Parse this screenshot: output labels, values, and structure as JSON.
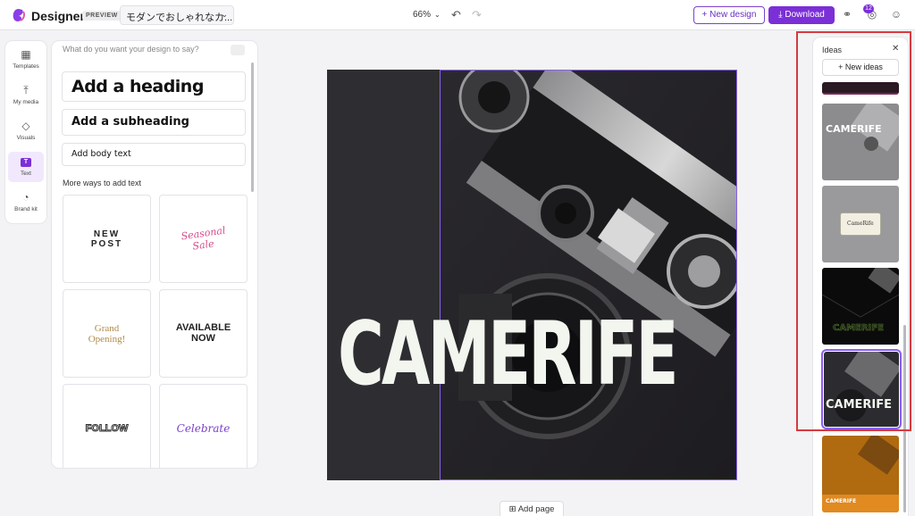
{
  "app": {
    "name": "Designer",
    "badge": "PREVIEW",
    "doc_title": "モダンでおしゃれなカ...",
    "zoom": "66%",
    "new_design": "New design",
    "download": "Download",
    "notifications": "12"
  },
  "rail": {
    "items": [
      {
        "label": "Templates",
        "icon": "templates-icon"
      },
      {
        "label": "My media",
        "icon": "upload-icon"
      },
      {
        "label": "Visuals",
        "icon": "shapes-icon"
      },
      {
        "label": "Text",
        "icon": "text-icon"
      },
      {
        "label": "Brand kit",
        "icon": "palette-icon"
      }
    ]
  },
  "text_panel": {
    "search_placeholder": "What do you want your design to say?",
    "add_heading": "Add a heading",
    "add_subheading": "Add a subheading",
    "add_body": "Add body text",
    "more_ways": "More ways to add text",
    "cards": [
      {
        "line1": "NEW",
        "line2": "POST"
      },
      {
        "line1": "Seasonal",
        "line2": "Sale"
      },
      {
        "line1": "Grand",
        "line2": "Opening!"
      },
      {
        "line1": "AVAILABLE",
        "line2": "NOW"
      },
      {
        "line1": "FOLLOW",
        "line2": ""
      },
      {
        "line1": "Celebrate",
        "line2": ""
      }
    ]
  },
  "canvas": {
    "headline": "CAMERIFE",
    "add_page": "Add page"
  },
  "ideas": {
    "title": "Ideas",
    "new_ideas": "New ideas",
    "thumbs": [
      {
        "caption": "CAMERIFE"
      },
      {
        "caption": "CameRife"
      },
      {
        "caption": "CAMERIFE"
      },
      {
        "caption": "CAMERIFE"
      },
      {
        "caption": "CAMERIFE"
      }
    ]
  },
  "colors": {
    "accent": "#7b2fd6",
    "highlight": "#d63a3f",
    "canvas_bg": "#2e2d31",
    "headline": "#f2f6ef"
  }
}
